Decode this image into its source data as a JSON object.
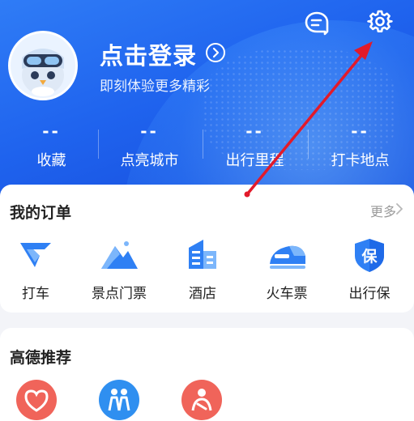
{
  "header": {
    "login_title": "点击登录",
    "login_subtitle": "即刻体验更多精彩",
    "stats": [
      {
        "value": "--",
        "label": "收藏"
      },
      {
        "value": "--",
        "label": "点亮城市"
      },
      {
        "value": "--",
        "label": "出行里程"
      },
      {
        "value": "--",
        "label": "打卡地点"
      }
    ]
  },
  "orders": {
    "title": "我的订单",
    "more_label": "更多",
    "items": [
      {
        "label": "打车",
        "icon": "taxi-icon"
      },
      {
        "label": "景点门票",
        "icon": "mountain-ticket-icon"
      },
      {
        "label": "酒店",
        "icon": "hotel-building-icon"
      },
      {
        "label": "火车票",
        "icon": "train-icon"
      },
      {
        "label": "出行保",
        "icon": "insurance-shield-icon"
      }
    ]
  },
  "recommend": {
    "title": "高德推荐",
    "items": [
      {
        "icon": "heart-hands-icon",
        "color": "#f0645a"
      },
      {
        "icon": "people-icon",
        "color": "#2f8ff0"
      },
      {
        "icon": "person-icon",
        "color": "#f0645a"
      }
    ]
  },
  "colors": {
    "header_blue": "#1f63ee",
    "accent_blue": "#2f80f4",
    "annotation_red": "#e21a2a"
  }
}
